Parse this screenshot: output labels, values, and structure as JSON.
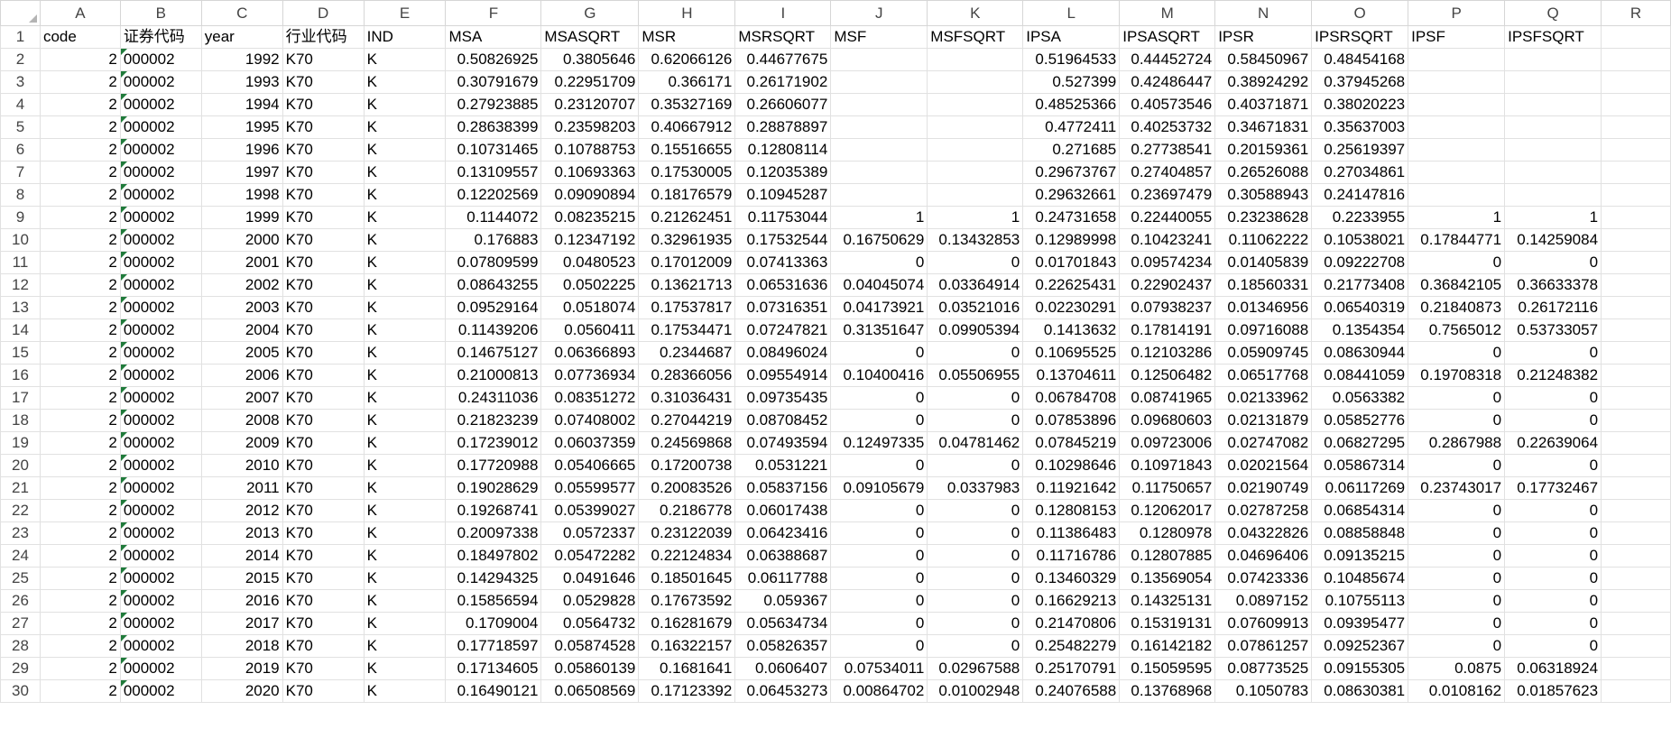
{
  "sheet": {
    "column_letters": [
      "A",
      "B",
      "C",
      "D",
      "E",
      "F",
      "G",
      "H",
      "I",
      "J",
      "K",
      "L",
      "M",
      "N",
      "O",
      "P",
      "Q",
      "R"
    ],
    "row_numbers": [
      "1",
      "2",
      "3",
      "4",
      "5",
      "6",
      "7",
      "8",
      "9",
      "10",
      "11",
      "12",
      "13",
      "14",
      "15",
      "16",
      "17",
      "18",
      "19",
      "20",
      "21",
      "22",
      "23",
      "24",
      "25",
      "26",
      "27",
      "28",
      "29",
      "30"
    ],
    "rows": [
      [
        "code",
        "证券代码",
        "year",
        "行业代码",
        "IND",
        "MSA",
        "MSASQRT",
        "MSR",
        "MSRSQRT",
        "MSF",
        "MSFSQRT",
        "IPSA",
        "IPSASQRT",
        "IPSR",
        "IPSRSQRT",
        "IPSF",
        "IPSFSQRT",
        ""
      ],
      [
        "2",
        "000002",
        "1992",
        "K70",
        "K",
        "0.50826925",
        "0.3805646",
        "0.62066126",
        "0.44677675",
        "",
        "",
        "0.51964533",
        "0.44452724",
        "0.58450967",
        "0.48454168",
        "",
        "",
        ""
      ],
      [
        "2",
        "000002",
        "1993",
        "K70",
        "K",
        "0.30791679",
        "0.22951709",
        "0.366171",
        "0.26171902",
        "",
        "",
        "0.527399",
        "0.42486447",
        "0.38924292",
        "0.37945268",
        "",
        "",
        ""
      ],
      [
        "2",
        "000002",
        "1994",
        "K70",
        "K",
        "0.27923885",
        "0.23120707",
        "0.35327169",
        "0.26606077",
        "",
        "",
        "0.48525366",
        "0.40573546",
        "0.40371871",
        "0.38020223",
        "",
        "",
        ""
      ],
      [
        "2",
        "000002",
        "1995",
        "K70",
        "K",
        "0.28638399",
        "0.23598203",
        "0.40667912",
        "0.28878897",
        "",
        "",
        "0.4772411",
        "0.40253732",
        "0.34671831",
        "0.35637003",
        "",
        "",
        ""
      ],
      [
        "2",
        "000002",
        "1996",
        "K70",
        "K",
        "0.10731465",
        "0.10788753",
        "0.15516655",
        "0.12808114",
        "",
        "",
        "0.271685",
        "0.27738541",
        "0.20159361",
        "0.25619397",
        "",
        "",
        ""
      ],
      [
        "2",
        "000002",
        "1997",
        "K70",
        "K",
        "0.13109557",
        "0.10693363",
        "0.17530005",
        "0.12035389",
        "",
        "",
        "0.29673767",
        "0.27404857",
        "0.26526088",
        "0.27034861",
        "",
        "",
        ""
      ],
      [
        "2",
        "000002",
        "1998",
        "K70",
        "K",
        "0.12202569",
        "0.09090894",
        "0.18176579",
        "0.10945287",
        "",
        "",
        "0.29632661",
        "0.23697479",
        "0.30588943",
        "0.24147816",
        "",
        "",
        ""
      ],
      [
        "2",
        "000002",
        "1999",
        "K70",
        "K",
        "0.1144072",
        "0.08235215",
        "0.21262451",
        "0.11753044",
        "1",
        "1",
        "0.24731658",
        "0.22440055",
        "0.23238628",
        "0.2233955",
        "1",
        "1",
        ""
      ],
      [
        "2",
        "000002",
        "2000",
        "K70",
        "K",
        "0.176883",
        "0.12347192",
        "0.32961935",
        "0.17532544",
        "0.16750629",
        "0.13432853",
        "0.12989998",
        "0.10423241",
        "0.11062222",
        "0.10538021",
        "0.17844771",
        "0.14259084",
        ""
      ],
      [
        "2",
        "000002",
        "2001",
        "K70",
        "K",
        "0.07809599",
        "0.0480523",
        "0.17012009",
        "0.07413363",
        "0",
        "0",
        "0.01701843",
        "0.09574234",
        "0.01405839",
        "0.09222708",
        "0",
        "0",
        ""
      ],
      [
        "2",
        "000002",
        "2002",
        "K70",
        "K",
        "0.08643255",
        "0.0502225",
        "0.13621713",
        "0.06531636",
        "0.04045074",
        "0.03364914",
        "0.22625431",
        "0.22902437",
        "0.18560331",
        "0.21773408",
        "0.36842105",
        "0.36633378",
        ""
      ],
      [
        "2",
        "000002",
        "2003",
        "K70",
        "K",
        "0.09529164",
        "0.0518074",
        "0.17537817",
        "0.07316351",
        "0.04173921",
        "0.03521016",
        "0.02230291",
        "0.07938237",
        "0.01346956",
        "0.06540319",
        "0.21840873",
        "0.26172116",
        ""
      ],
      [
        "2",
        "000002",
        "2004",
        "K70",
        "K",
        "0.11439206",
        "0.0560411",
        "0.17534471",
        "0.07247821",
        "0.31351647",
        "0.09905394",
        "0.1413632",
        "0.17814191",
        "0.09716088",
        "0.1354354",
        "0.7565012",
        "0.53733057",
        ""
      ],
      [
        "2",
        "000002",
        "2005",
        "K70",
        "K",
        "0.14675127",
        "0.06366893",
        "0.2344687",
        "0.08496024",
        "0",
        "0",
        "0.10695525",
        "0.12103286",
        "0.05909745",
        "0.08630944",
        "0",
        "0",
        ""
      ],
      [
        "2",
        "000002",
        "2006",
        "K70",
        "K",
        "0.21000813",
        "0.07736934",
        "0.28366056",
        "0.09554914",
        "0.10400416",
        "0.05506955",
        "0.13704611",
        "0.12506482",
        "0.06517768",
        "0.08441059",
        "0.19708318",
        "0.21248382",
        ""
      ],
      [
        "2",
        "000002",
        "2007",
        "K70",
        "K",
        "0.24311036",
        "0.08351272",
        "0.31036431",
        "0.09735435",
        "0",
        "0",
        "0.06784708",
        "0.08741965",
        "0.02133962",
        "0.0563382",
        "0",
        "0",
        ""
      ],
      [
        "2",
        "000002",
        "2008",
        "K70",
        "K",
        "0.21823239",
        "0.07408002",
        "0.27044219",
        "0.08708452",
        "0",
        "0",
        "0.07853896",
        "0.09680603",
        "0.02131879",
        "0.05852776",
        "0",
        "0",
        ""
      ],
      [
        "2",
        "000002",
        "2009",
        "K70",
        "K",
        "0.17239012",
        "0.06037359",
        "0.24569868",
        "0.07493594",
        "0.12497335",
        "0.04781462",
        "0.07845219",
        "0.09723006",
        "0.02747082",
        "0.06827295",
        "0.2867988",
        "0.22639064",
        ""
      ],
      [
        "2",
        "000002",
        "2010",
        "K70",
        "K",
        "0.17720988",
        "0.05406665",
        "0.17200738",
        "0.0531221",
        "0",
        "0",
        "0.10298646",
        "0.10971843",
        "0.02021564",
        "0.05867314",
        "0",
        "0",
        ""
      ],
      [
        "2",
        "000002",
        "2011",
        "K70",
        "K",
        "0.19028629",
        "0.05599577",
        "0.20083526",
        "0.05837156",
        "0.09105679",
        "0.0337983",
        "0.11921642",
        "0.11750657",
        "0.02190749",
        "0.06117269",
        "0.23743017",
        "0.17732467",
        ""
      ],
      [
        "2",
        "000002",
        "2012",
        "K70",
        "K",
        "0.19268741",
        "0.05399027",
        "0.2186778",
        "0.06017438",
        "0",
        "0",
        "0.12808153",
        "0.12062017",
        "0.02787258",
        "0.06854314",
        "0",
        "0",
        ""
      ],
      [
        "2",
        "000002",
        "2013",
        "K70",
        "K",
        "0.20097338",
        "0.0572337",
        "0.23122039",
        "0.06423416",
        "0",
        "0",
        "0.11386483",
        "0.1280978",
        "0.04322826",
        "0.08858848",
        "0",
        "0",
        ""
      ],
      [
        "2",
        "000002",
        "2014",
        "K70",
        "K",
        "0.18497802",
        "0.05472282",
        "0.22124834",
        "0.06388687",
        "0",
        "0",
        "0.11716786",
        "0.12807885",
        "0.04696406",
        "0.09135215",
        "0",
        "0",
        ""
      ],
      [
        "2",
        "000002",
        "2015",
        "K70",
        "K",
        "0.14294325",
        "0.0491646",
        "0.18501645",
        "0.06117788",
        "0",
        "0",
        "0.13460329",
        "0.13569054",
        "0.07423336",
        "0.10485674",
        "0",
        "0",
        ""
      ],
      [
        "2",
        "000002",
        "2016",
        "K70",
        "K",
        "0.15856594",
        "0.0529828",
        "0.17673592",
        "0.059367",
        "0",
        "0",
        "0.16629213",
        "0.14325131",
        "0.0897152",
        "0.10755113",
        "0",
        "0",
        ""
      ],
      [
        "2",
        "000002",
        "2017",
        "K70",
        "K",
        "0.1709004",
        "0.0564732",
        "0.16281679",
        "0.05634734",
        "0",
        "0",
        "0.21470806",
        "0.15319131",
        "0.07609913",
        "0.09395477",
        "0",
        "0",
        ""
      ],
      [
        "2",
        "000002",
        "2018",
        "K70",
        "K",
        "0.17718597",
        "0.05874528",
        "0.16322157",
        "0.05826357",
        "0",
        "0",
        "0.25482279",
        "0.16142182",
        "0.07861257",
        "0.09252367",
        "0",
        "0",
        ""
      ],
      [
        "2",
        "000002",
        "2019",
        "K70",
        "K",
        "0.17134605",
        "0.05860139",
        "0.1681641",
        "0.0606407",
        "0.07534011",
        "0.02967588",
        "0.25170791",
        "0.15059595",
        "0.08773525",
        "0.09155305",
        "0.0875",
        "0.06318924",
        ""
      ],
      [
        "2",
        "000002",
        "2020",
        "K70",
        "K",
        "0.16490121",
        "0.06508569",
        "0.17123392",
        "0.06453273",
        "0.00864702",
        "0.01002948",
        "0.24076588",
        "0.13768968",
        "0.1050783",
        "0.08630381",
        "0.0108162",
        "0.01857623",
        ""
      ]
    ]
  }
}
